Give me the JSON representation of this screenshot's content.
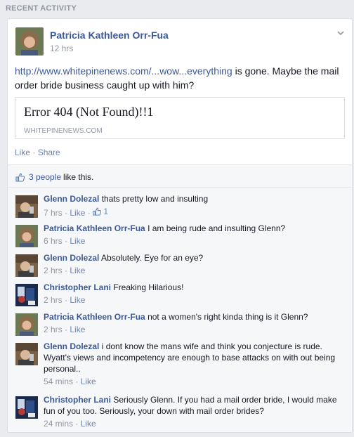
{
  "section_title": "RECENT ACTIVITY",
  "post": {
    "author": "Patricia Kathleen Orr-Fua",
    "time": "12 hrs",
    "link_text": "http://www.whitepinenews.com/...wow...everything",
    "text_rest": " is gone. Maybe the mail order bride business caught up with him?",
    "link_card": {
      "title": "Error 404 (Not Found)!!1",
      "domain": "WHITEPINENEWS.COM"
    },
    "actions": {
      "like": "Like",
      "separator": " · ",
      "share": "Share"
    }
  },
  "likes": {
    "count": "3 people",
    "suffix": "like this."
  },
  "comments": [
    {
      "author": "Glenn Dolezal",
      "text": "thats pretty low and insulting",
      "time": "7 hrs",
      "like": "Like",
      "like_count": "1"
    },
    {
      "author": "Patricia Kathleen Orr-Fua",
      "text": "I am being rude and insulting Glenn?",
      "time": "6 hrs",
      "like": "Like"
    },
    {
      "author": "Glenn Dolezal",
      "text": "Absolutely. Eye for an eye?",
      "time": "2 hrs",
      "like": "Like"
    },
    {
      "author": "Christopher Lani",
      "text": "Freaking Hilarious!",
      "time": "2 hrs",
      "like": "Like"
    },
    {
      "author": "Patricia Kathleen Orr-Fua",
      "text": "not a women's right kinda thing is it Glenn?",
      "time": "2 hrs",
      "like": "Like"
    },
    {
      "author": "Glenn Dolezal",
      "text": "i dont know the mans wife and think you conjecture is rude. Wyatt's views and incompetency are enough to base attacks on with out being personal..",
      "time": "54 mins",
      "like": "Like"
    },
    {
      "author": "Christopher Lani",
      "text": "Seriously Glenn. If you had a mail order bride, I would make fun of you too. Seriously, your down with mail order brides?",
      "time": "24 mins",
      "like": "Like"
    }
  ]
}
